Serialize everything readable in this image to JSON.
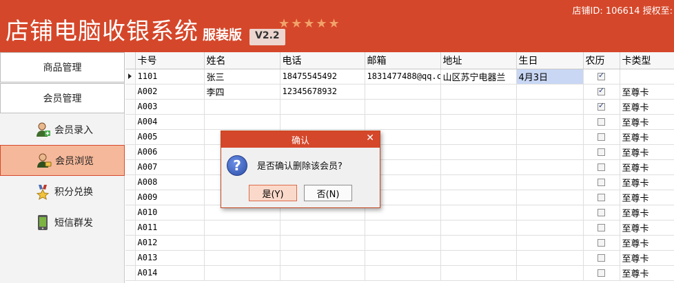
{
  "header": {
    "title": "店铺电脑收银系统",
    "edition": "服装版",
    "version": "V2.2",
    "stars": "★★★★★",
    "store_info": "店铺ID: 106614 授权至:"
  },
  "sidebar": {
    "sections": [
      {
        "label": "商品管理"
      },
      {
        "label": "会员管理"
      }
    ],
    "items": [
      {
        "label": "会员录入",
        "icon": "member-add-icon",
        "active": false
      },
      {
        "label": "会员浏览",
        "icon": "member-browse-icon",
        "active": true
      },
      {
        "label": "积分兑换",
        "icon": "medal-icon",
        "active": false
      },
      {
        "label": "短信群发",
        "icon": "phone-sms-icon",
        "active": false
      }
    ]
  },
  "grid": {
    "columns": [
      "卡号",
      "姓名",
      "电话",
      "邮箱",
      "地址",
      "生日",
      "农历",
      "卡类型"
    ],
    "rows": [
      {
        "card": "1101",
        "name": "张三",
        "phone": "18475545492",
        "email": "1831477488@qq.c",
        "address": "山区苏宁电器兰",
        "birthday": "4月3日",
        "lunar": true,
        "card_type": ""
      },
      {
        "card": "A002",
        "name": "李四",
        "phone": "12345678932",
        "email": "",
        "address": "",
        "birthday": "",
        "lunar": true,
        "card_type": "至尊卡"
      },
      {
        "card": "A003",
        "name": "",
        "phone": "",
        "email": "",
        "address": "",
        "birthday": "",
        "lunar": true,
        "card_type": "至尊卡"
      },
      {
        "card": "A004",
        "name": "",
        "phone": "",
        "email": "",
        "address": "",
        "birthday": "",
        "lunar": false,
        "card_type": "至尊卡"
      },
      {
        "card": "A005",
        "name": "",
        "phone": "",
        "email": "",
        "address": "",
        "birthday": "",
        "lunar": false,
        "card_type": "至尊卡"
      },
      {
        "card": "A006",
        "name": "",
        "phone": "",
        "email": "",
        "address": "",
        "birthday": "",
        "lunar": false,
        "card_type": "至尊卡"
      },
      {
        "card": "A007",
        "name": "",
        "phone": "",
        "email": "",
        "address": "",
        "birthday": "",
        "lunar": false,
        "card_type": "至尊卡"
      },
      {
        "card": "A008",
        "name": "",
        "phone": "",
        "email": "",
        "address": "",
        "birthday": "",
        "lunar": false,
        "card_type": "至尊卡"
      },
      {
        "card": "A009",
        "name": "",
        "phone": "",
        "email": "",
        "address": "",
        "birthday": "",
        "lunar": false,
        "card_type": "至尊卡"
      },
      {
        "card": "A010",
        "name": "",
        "phone": "",
        "email": "",
        "address": "",
        "birthday": "",
        "lunar": false,
        "card_type": "至尊卡"
      },
      {
        "card": "A011",
        "name": "",
        "phone": "",
        "email": "",
        "address": "",
        "birthday": "",
        "lunar": false,
        "card_type": "至尊卡"
      },
      {
        "card": "A012",
        "name": "",
        "phone": "",
        "email": "",
        "address": "",
        "birthday": "",
        "lunar": false,
        "card_type": "至尊卡"
      },
      {
        "card": "A013",
        "name": "",
        "phone": "",
        "email": "",
        "address": "",
        "birthday": "",
        "lunar": false,
        "card_type": "至尊卡"
      },
      {
        "card": "A014",
        "name": "",
        "phone": "",
        "email": "",
        "address": "",
        "birthday": "",
        "lunar": false,
        "card_type": "至尊卡"
      }
    ]
  },
  "dialog": {
    "title": "确认",
    "message": "是否确认删除该会员?",
    "yes_label": "是(Y)",
    "no_label": "否(N)",
    "close_glyph": "✕",
    "icon_glyph": "?"
  },
  "colors": {
    "brand": "#d5472a",
    "active_item": "#f6b89a",
    "selection": "#c9d7f4"
  }
}
